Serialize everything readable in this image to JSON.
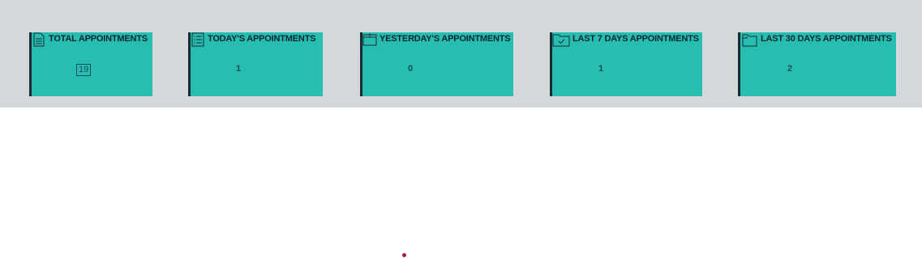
{
  "colors": {
    "band_background": "#d4d8db",
    "card_background": "#27bdb1",
    "card_accent": "#1a2a33",
    "cursor": "#a0185a"
  },
  "cards": [
    {
      "icon": "document-icon",
      "title": "TOTAL APPOINTMENTS",
      "value": "19"
    },
    {
      "icon": "list-icon",
      "title": "TODAY'S APPOINTMENTS",
      "value": "1"
    },
    {
      "icon": "calendar-icon",
      "title": "YESTERDAY'S APPOINTMENTS",
      "value": "0"
    },
    {
      "icon": "folder-check-icon",
      "title": "LAST 7 DAYS APPOINTMENTS",
      "value": "1"
    },
    {
      "icon": "folder-icon",
      "title": "LAST 30 DAYS APPOINTMENTS",
      "value": "2"
    }
  ]
}
